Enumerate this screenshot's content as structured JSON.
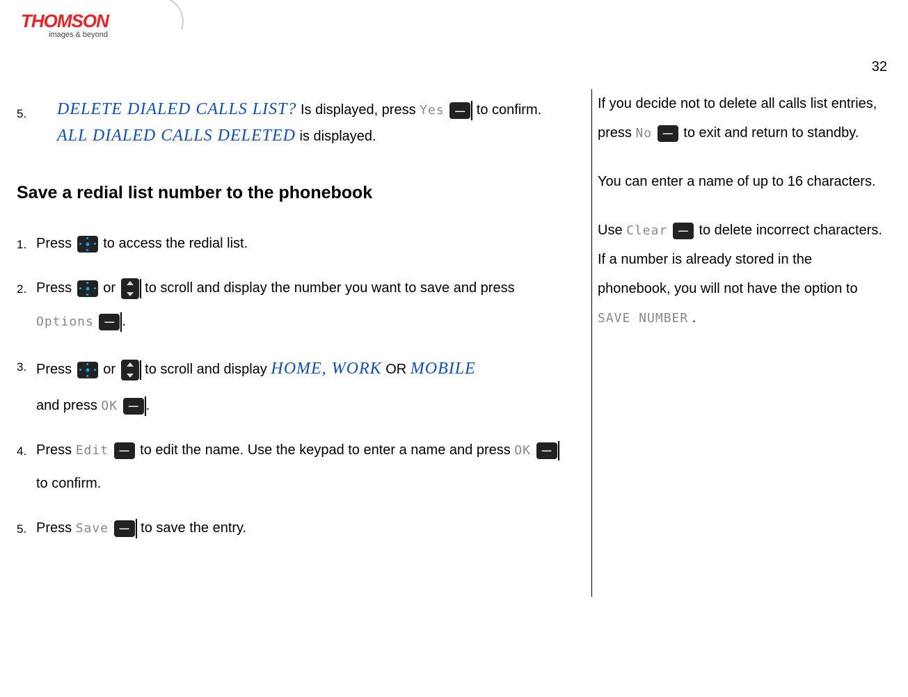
{
  "logo": {
    "brand": "THOMSON",
    "tagline": "images & beyond"
  },
  "page_number": "32",
  "step5_first": {
    "num": "5.",
    "display_q": "DELETE DIALED CALLS LIST?",
    "text1": " Is displayed, press ",
    "btn_yes": "Yes",
    "text2": "to confirm. ",
    "display_confirm": "ALL DIALED CALLS DELETED",
    "text3": "is displayed."
  },
  "heading": "Save a redial list number to the phonebook",
  "steps": [
    {
      "num": "1.",
      "pre": "Press ",
      "post": "to access the redial list."
    },
    {
      "num": "2.",
      "pre": "Press ",
      "mid": "or ",
      "after": "to scroll and display the number you want to save and press ",
      "btn_opt": "Options",
      "end": "."
    },
    {
      "num": "3.",
      "pre": "Press ",
      "mid": "or ",
      "after": "to scroll and display ",
      "display": "HOME, WORK",
      "or_word": " OR ",
      "display2": "MOBILE",
      "line2_pre": "and press ",
      "btn_ok": "OK",
      "end": "."
    },
    {
      "num": "4.",
      "pre": "Press ",
      "btn_edit": "Edit",
      "after": " to edit the name.  Use the keypad to enter a name and press ",
      "btn_ok": "OK",
      "end": "to confirm."
    },
    {
      "num": "5.",
      "pre": "Press ",
      "btn_save": "Save",
      "end": "to save the entry."
    }
  ],
  "side": {
    "para1_a": "If you decide not to delete all calls list entries, press ",
    "btn_no": "No",
    "para1_b": "to exit and return to standby.",
    "para2": "You can enter a name of up to 16 characters.",
    "para3_a": "Use ",
    "btn_clear": "Clear",
    "para3_b": "to delete incorrect characters.",
    "para4": "If a number is already stored in the phonebook, you will not have the option to ",
    "lcd_save": "SAVE NUMBER",
    "para4_end": " ."
  }
}
